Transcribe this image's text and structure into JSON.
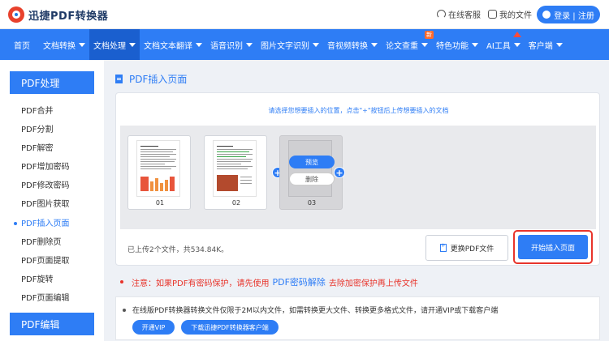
{
  "header": {
    "logo_text": "迅捷PDF转换器",
    "service_label": "在线客服",
    "myfiles_label": "我的文件",
    "login_label": "登录 | 注册"
  },
  "nav": {
    "items": [
      {
        "label": "首页"
      },
      {
        "label": "文档转换"
      },
      {
        "label": "文档处理"
      },
      {
        "label": "文档文本翻译"
      },
      {
        "label": "语音识别"
      },
      {
        "label": "图片文字识别"
      },
      {
        "label": "音视频转换"
      },
      {
        "label": "论文查重"
      },
      {
        "label": "特色功能"
      },
      {
        "label": "AI工具"
      },
      {
        "label": "客户端"
      }
    ],
    "new_badge": "新",
    "accent": "#2e7df5"
  },
  "sidebar": {
    "section1_title": "PDF处理",
    "items": [
      {
        "label": "PDF合并"
      },
      {
        "label": "PDF分割"
      },
      {
        "label": "PDF解密"
      },
      {
        "label": "PDF增加密码"
      },
      {
        "label": "PDF修改密码"
      },
      {
        "label": "PDF图片获取"
      },
      {
        "label": "PDF插入页面"
      },
      {
        "label": "PDF删除页"
      },
      {
        "label": "PDF页面提取"
      },
      {
        "label": "PDF旋转"
      },
      {
        "label": "PDF页面编辑"
      }
    ],
    "active_item": "PDF插入页面",
    "section2_title": "PDF编辑"
  },
  "main": {
    "title": "PDF插入页面",
    "tip": "请选择您想要插入的位置，点击\"+\"按钮后上传想要插入的文档",
    "pages": [
      {
        "num": "01"
      },
      {
        "num": "02"
      },
      {
        "num": "03"
      }
    ],
    "preview_label": "预览",
    "delete_label": "删除",
    "plus_symbol": "+",
    "upload_info": "已上传2个文件，共534.84K。",
    "change_label": "更换PDF文件",
    "start_label": "开始插入页面"
  },
  "notice": {
    "prefix": "注意：如果PDF有密码保护，请先使用",
    "link": "PDF密码解除",
    "suffix": "去除加密保护再上传文件"
  },
  "info": {
    "text": "在线版PDF转换器转换文件仅限于2M以内文件，如需转换更大文件、转换更多格式文件，请开通VIP或下载客户端",
    "vip_label": "开通VIP",
    "download_label": "下载迅捷PDF转换器客户端"
  }
}
